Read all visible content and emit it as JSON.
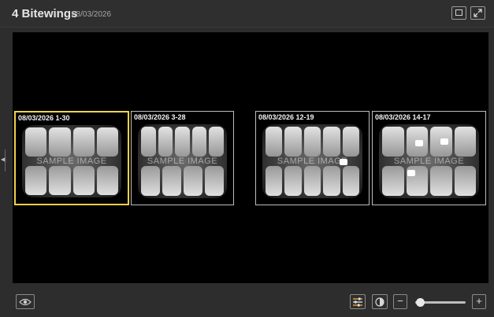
{
  "header": {
    "title": "4 Bitewings",
    "date": "08/03/2026",
    "buttons": [
      "single-view-icon",
      "expand-icon"
    ]
  },
  "thumbnails": [
    {
      "label": "08/03/2026 1-30",
      "watermark": "SAMPLE IMAGE",
      "selected": true
    },
    {
      "label": "08/03/2026 3-28",
      "watermark": "SAMPLE IMAGE",
      "selected": false
    },
    {
      "label": "08/03/2026 12-19",
      "watermark": "SAMPLE IMAGE",
      "selected": false
    },
    {
      "label": "08/03/2026 14-17",
      "watermark": "SAMPLE IMAGE",
      "selected": false
    }
  ],
  "footer": {
    "eye_icon": "eye-icon",
    "adjust_icon": "image-adjust-icon",
    "contrast_icon": "contrast-icon",
    "zoom_out_label": "−",
    "zoom_in_label": "+",
    "zoom_level": 0.1
  },
  "colors": {
    "selected_border": "#f0d24a",
    "adjust_icon_accent": "#e8a23a",
    "background": "#2d2d2d",
    "viewer": "#000000"
  }
}
